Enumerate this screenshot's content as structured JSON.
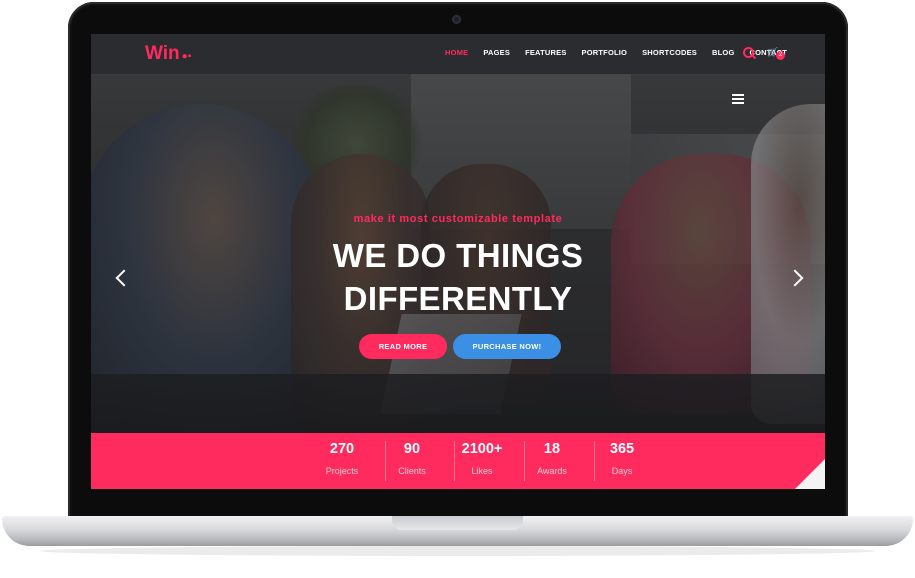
{
  "site": {
    "logo_text": "Win",
    "logo_dots": "●▪"
  },
  "nav": {
    "items": [
      "HOME",
      "PAGES",
      "FEATURES",
      "PORTFOLIO",
      "SHORTCODES",
      "BLOG",
      "CONTACT"
    ],
    "active_item": "HOME",
    "cart_count": "2"
  },
  "hero": {
    "tagline": "make it most customizable template",
    "headline_line1": "WE DO THINGS",
    "headline_line2": "DIFFERENTLY",
    "read_more_label": "READ MORE",
    "purchase_label": "PURCHASE NOW!"
  },
  "stats": [
    {
      "value": "270",
      "label": "Projects"
    },
    {
      "value": "90",
      "label": "Clients"
    },
    {
      "value": "2100+",
      "label": "Likes"
    },
    {
      "value": "18",
      "label": "Awards"
    },
    {
      "value": "365",
      "label": "Days"
    }
  ],
  "colors": {
    "accent": "#ff2a5e",
    "secondary": "#3b8fe4",
    "navbar": "#2b2c2f"
  },
  "icons": [
    "search-icon",
    "cart-icon",
    "hamburger-menu-icon",
    "chevron-left-icon",
    "chevron-right-icon",
    "webcam-icon"
  ]
}
